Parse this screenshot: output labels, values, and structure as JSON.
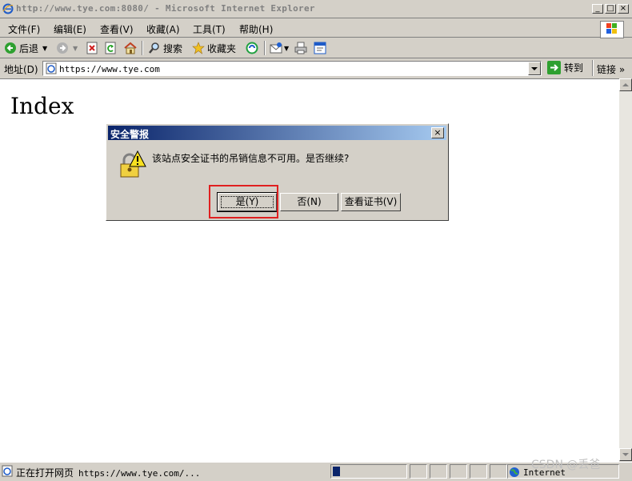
{
  "window": {
    "title": "http://www.tye.com:8080/ - Microsoft Internet Explorer",
    "minimize": "_",
    "maximize": "□",
    "close": "×"
  },
  "menu": [
    {
      "label": "文件(F)"
    },
    {
      "label": "编辑(E)"
    },
    {
      "label": "查看(V)"
    },
    {
      "label": "收藏(A)"
    },
    {
      "label": "工具(T)"
    },
    {
      "label": "帮助(H)"
    }
  ],
  "toolbar": {
    "back_label": "后退",
    "search_label": "搜索",
    "favorites_label": "收藏夹"
  },
  "address": {
    "label": "地址(D)",
    "value": "https://www.tye.com",
    "go_label": "转到",
    "links_label": "链接",
    "chevron": "»"
  },
  "page": {
    "heading": "Index"
  },
  "dialog": {
    "title": "安全警报",
    "close": "×",
    "message": "该站点安全证书的吊销信息不可用。是否继续?",
    "yes_label": "是(Y)",
    "no_label": "否(N)",
    "view_cert_label": "查看证书(V)",
    "highlight_color": "#e02020"
  },
  "status": {
    "text": "正在打开网页",
    "url": "https://www.tye.com/...",
    "zone": "Internet",
    "progress": 0.1
  },
  "watermark": "CSDN @丢爸",
  "colors": {
    "title_gradient_start": "#0a246a",
    "title_gradient_end": "#a6caf0",
    "face": "#d4d0c8"
  }
}
